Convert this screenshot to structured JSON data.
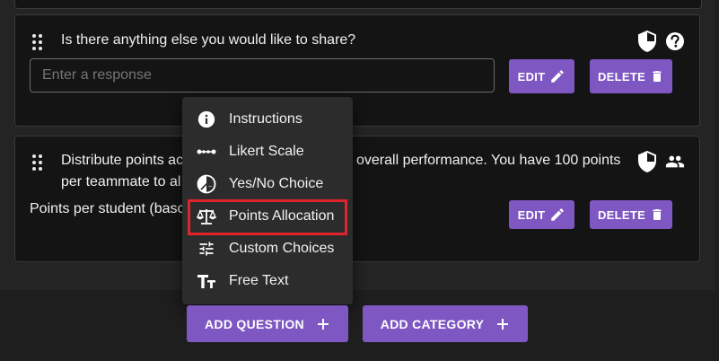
{
  "questions": [
    {
      "text": "Is there anything else you would like to share?",
      "input_placeholder": "Enter a response",
      "edit_label": "EDIT",
      "delete_label": "DELETE"
    },
    {
      "text_line1_left": "Distribute points ac",
      "text_line1_right": "overall performance. You have 100 points",
      "text_line2": "per teammate to al",
      "partial_label": "Points per student (basc",
      "edit_label": "EDIT",
      "delete_label": "DELETE"
    }
  ],
  "menu": {
    "items": [
      {
        "label": "Instructions",
        "icon": "info-icon"
      },
      {
        "label": "Likert Scale",
        "icon": "likert-scale-icon"
      },
      {
        "label": "Yes/No Choice",
        "icon": "yes-no-icon"
      },
      {
        "label": "Points Allocation",
        "icon": "balance-scale-icon"
      },
      {
        "label": "Custom Choices",
        "icon": "tune-icon"
      },
      {
        "label": "Free Text",
        "icon": "text-size-icon"
      }
    ],
    "highlighted_item": "Points Allocation"
  },
  "footer": {
    "add_question_label": "ADD QUESTION",
    "add_category_label": "ADD CATEGORY"
  },
  "colors": {
    "accent": "#7e57c2",
    "highlight": "#e0242b",
    "card_bg": "#141414",
    "menu_bg": "#2c2c2c"
  }
}
